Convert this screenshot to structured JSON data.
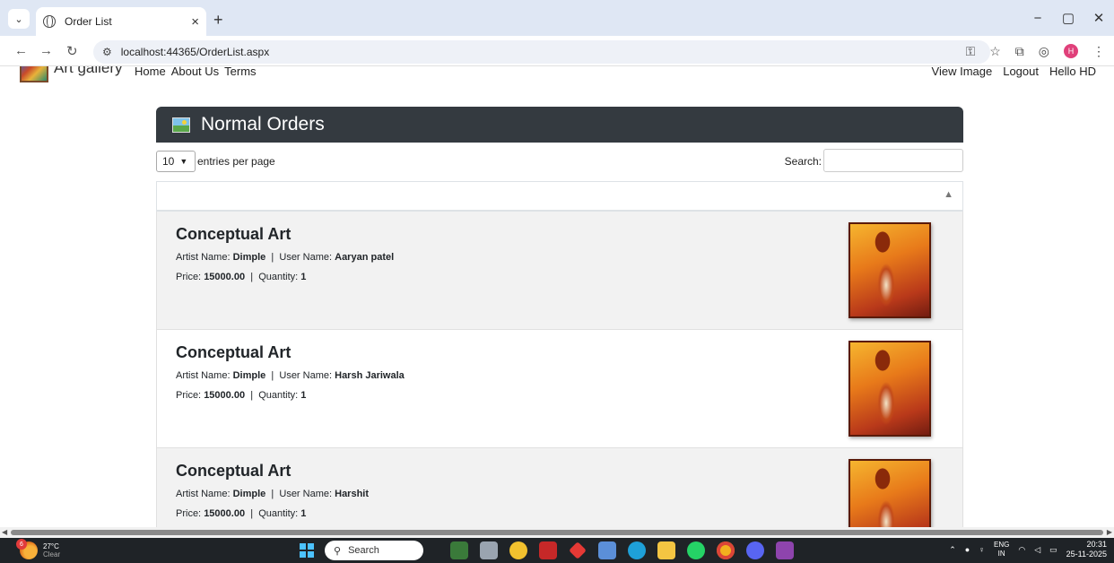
{
  "browser": {
    "tab_title": "Order List",
    "tab_close": "×",
    "new_tab": "+",
    "url": "localhost:44365/OrderList.aspx",
    "win_minimize": "−",
    "win_restore": "▢",
    "win_close": "✕"
  },
  "site": {
    "brand": "Art gallery",
    "nav": [
      "Home",
      "About Us",
      "Terms"
    ],
    "nav_right": [
      "View Image",
      "Logout",
      "Hello HD"
    ]
  },
  "panel": {
    "title": "Normal Orders",
    "page_size": "10",
    "entries_label": "entries per page",
    "search_label": "Search:",
    "search_value": ""
  },
  "orders": [
    {
      "title": "Conceptual Art",
      "artist_label": "Artist Name:",
      "artist": "Dimple",
      "user_label": "User Name:",
      "user": "Aaryan patel",
      "price_label": "Price:",
      "price": "15000.00",
      "qty_label": "Quantity:",
      "qty": "1",
      "sep": "|"
    },
    {
      "title": "Conceptual Art",
      "artist_label": "Artist Name:",
      "artist": "Dimple",
      "user_label": "User Name:",
      "user": "Harsh Jariwala",
      "price_label": "Price:",
      "price": "15000.00",
      "qty_label": "Quantity:",
      "qty": "1",
      "sep": "|"
    },
    {
      "title": "Conceptual Art",
      "artist_label": "Artist Name:",
      "artist": "Dimple",
      "user_label": "User Name:",
      "user": "Harshit",
      "price_label": "Price:",
      "price": "15000.00",
      "qty_label": "Quantity:",
      "qty": "1",
      "sep": "|"
    }
  ],
  "taskbar": {
    "weather_badge": "6",
    "temp": "27°C",
    "condition": "Clear",
    "search": "Search",
    "lang_top": "ENG",
    "lang_bottom": "IN",
    "time": "20:31",
    "date": "25-11-2025"
  },
  "colors": {
    "panel_header": "#343a40",
    "stripe": "#f2f2f2",
    "taskbar": "#1f2327"
  }
}
